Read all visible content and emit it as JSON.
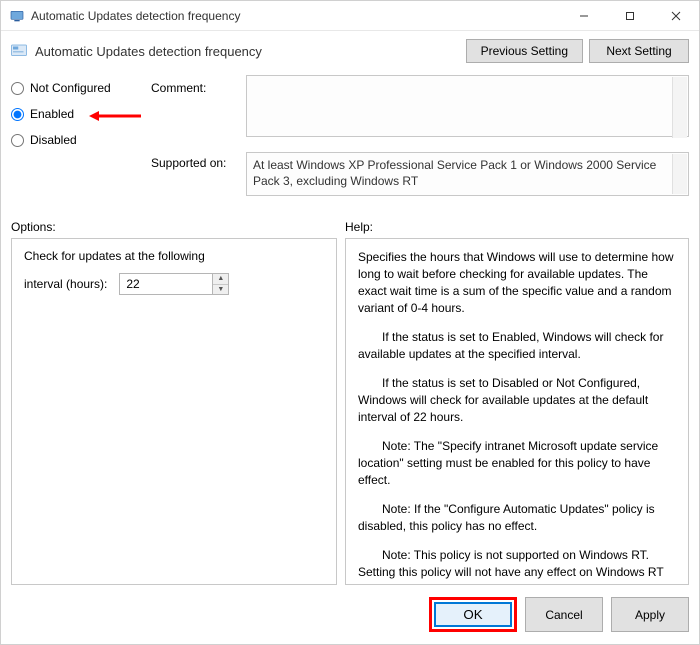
{
  "window": {
    "title": "Automatic Updates detection frequency"
  },
  "header": {
    "subtitle": "Automatic Updates detection frequency",
    "prev_label": "Previous Setting",
    "next_label": "Next Setting"
  },
  "state": {
    "not_configured_label": "Not Configured",
    "enabled_label": "Enabled",
    "disabled_label": "Disabled",
    "selected": "enabled"
  },
  "comment": {
    "label": "Comment:",
    "value": ""
  },
  "supported": {
    "label": "Supported on:",
    "text": "At least Windows XP Professional Service Pack 1 or Windows 2000 Service Pack 3, excluding Windows RT"
  },
  "section_labels": {
    "options": "Options:",
    "help": "Help:"
  },
  "options": {
    "line1": "Check for updates at the following",
    "interval_label": "interval (hours):",
    "interval_value": "22"
  },
  "help": {
    "p1": "Specifies the hours that Windows will use to determine how long to wait before checking for available updates. The exact wait time is a sum of the specific value and a random variant of 0-4 hours.",
    "p2": "If the status is set to Enabled, Windows will check for available updates at the specified interval.",
    "p3": "If the status is set to Disabled or Not Configured, Windows will check for available updates at the default interval of 22 hours.",
    "p4": "Note: The \"Specify intranet Microsoft update service location\" setting must be enabled for this policy to have effect.",
    "p5": "Note: If the \"Configure Automatic Updates\" policy is disabled, this policy has no effect.",
    "p6": "Note: This policy is not supported on Windows RT. Setting this policy will not have any effect on Windows RT PCs."
  },
  "footer": {
    "ok": "OK",
    "cancel": "Cancel",
    "apply": "Apply"
  }
}
